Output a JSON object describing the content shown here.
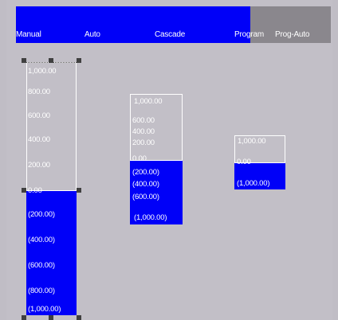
{
  "modes": {
    "manual": "Manual",
    "auto": "Auto",
    "cascade": "Cascade",
    "program": "Program",
    "prog_auto": "Prog-Auto",
    "colors": {
      "active": "#0000f8",
      "inactive": "#8a878d"
    }
  },
  "bar1": {
    "ticks": [
      "1,000.00",
      "800.00",
      "600.00",
      "400.00",
      "200.00",
      "0.00",
      "(200.00)",
      "(400.00)",
      "(600.00)",
      "(800.00)",
      "(1,000.00)"
    ],
    "selected": true
  },
  "bar2": {
    "ticks": [
      "1,000.00",
      "600.00",
      "400.00",
      "200.00",
      "0.00",
      "(200.00)",
      "(400.00)",
      "(600.00)",
      "(1,000.00)"
    ]
  },
  "bar3": {
    "ticks": [
      "1,000.00",
      "0.00",
      "(1,000.00)"
    ]
  }
}
